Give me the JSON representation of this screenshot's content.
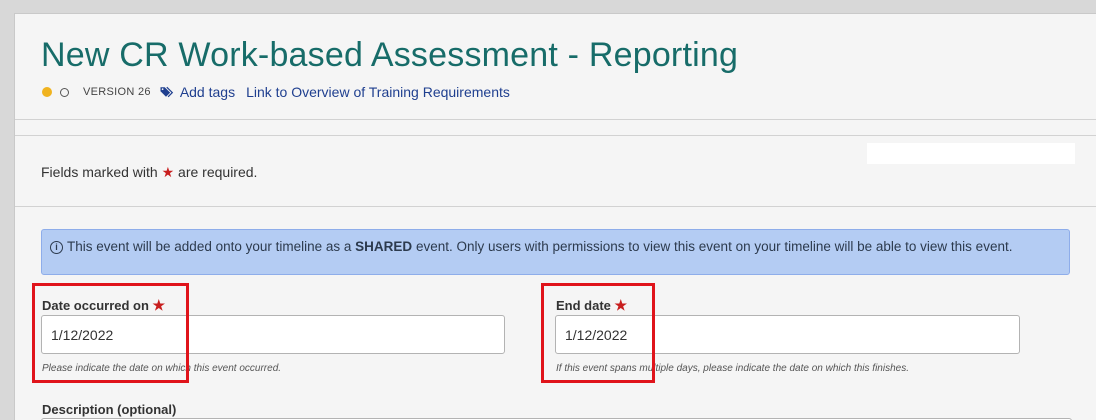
{
  "header": {
    "title": "New CR Work-based Assessment - Reporting",
    "version_label": "VERSION 26",
    "add_tags_label": "Add tags",
    "overview_link_label": "Link to Overview of Training Requirements"
  },
  "status_colors": {
    "filled_dot": "#f0b31f",
    "required_star": "#c81e1e",
    "highlight_box": "#e0141b"
  },
  "form": {
    "required_note_before": "Fields marked with ",
    "required_star": "★",
    "required_note_after": " are required.",
    "info_banner": {
      "icon": "info-icon",
      "text_before": "This event will be added onto your timeline as a ",
      "text_bold": "SHARED",
      "text_after": " event. Only users with permissions to view this event on your timeline will be able to view this event."
    },
    "date_occurred": {
      "label": "Date occurred on",
      "value": "1/12/2022",
      "help": "Please indicate the date on which this event occurred."
    },
    "end_date": {
      "label": "End date",
      "value": "1/12/2022",
      "help": "If this event spans multiple days, please indicate the date on which this finishes."
    },
    "description": {
      "label": "Description (optional)"
    }
  }
}
